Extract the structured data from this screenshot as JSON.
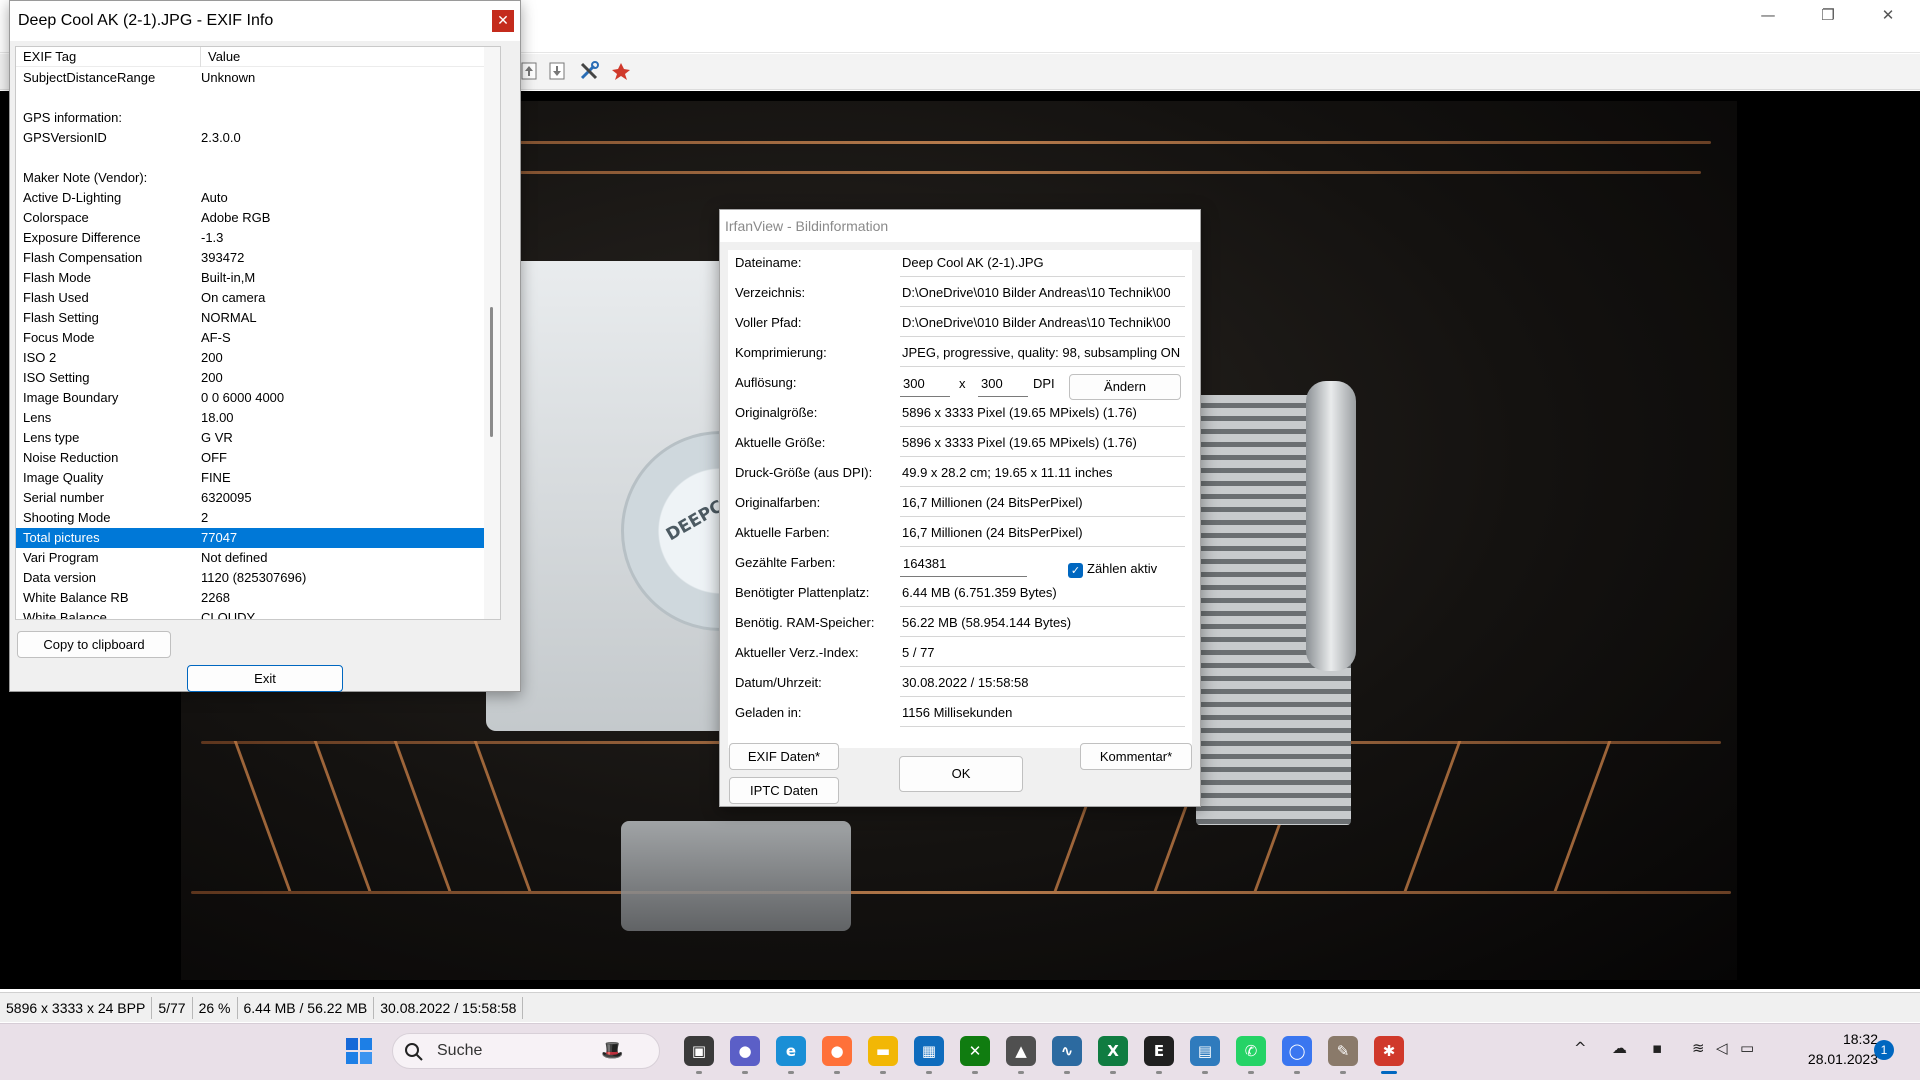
{
  "main_window": {
    "controls": {
      "minimize": "—",
      "maximize": "❐",
      "close": "✕"
    }
  },
  "toolbar_icons": [
    "move-up-icon",
    "move-down-icon",
    "tools-icon",
    "irfanview-icon"
  ],
  "photo": {
    "logo_text": "DEEPCOOL"
  },
  "statusbar": {
    "cells": [
      "5896 x 3333 x 24 BPP",
      "5/77",
      "26 %",
      "6.44 MB / 56.22 MB",
      "30.08.2022 / 15:58:58"
    ]
  },
  "exif_dialog": {
    "title": "Deep Cool AK (2-1).JPG - EXIF Info",
    "close": "✕",
    "columns": {
      "tag": "EXIF Tag",
      "value": "Value"
    },
    "rows": [
      {
        "tag": "SubjectDistanceRange",
        "value": "Unknown"
      },
      {
        "tag": "",
        "value": ""
      },
      {
        "tag": "GPS information:",
        "value": ""
      },
      {
        "tag": "GPSVersionID",
        "value": "2.3.0.0"
      },
      {
        "tag": "",
        "value": ""
      },
      {
        "tag": "Maker Note (Vendor):",
        "value": ""
      },
      {
        "tag": "Active D-Lighting",
        "value": "Auto"
      },
      {
        "tag": "Colorspace",
        "value": "Adobe RGB"
      },
      {
        "tag": "Exposure Difference",
        "value": "-1.3"
      },
      {
        "tag": "Flash Compensation",
        "value": "393472"
      },
      {
        "tag": "Flash Mode",
        "value": "Built-in,M"
      },
      {
        "tag": "Flash Used",
        "value": "On camera"
      },
      {
        "tag": "Flash Setting",
        "value": "NORMAL"
      },
      {
        "tag": "Focus Mode",
        "value": "AF-S"
      },
      {
        "tag": "ISO 2",
        "value": "200"
      },
      {
        "tag": "ISO Setting",
        "value": "200"
      },
      {
        "tag": "Image Boundary",
        "value": "0 0 6000 4000"
      },
      {
        "tag": "Lens",
        "value": "18.00"
      },
      {
        "tag": "Lens type",
        "value": "G VR"
      },
      {
        "tag": "Noise Reduction",
        "value": "OFF"
      },
      {
        "tag": "Image Quality",
        "value": "FINE"
      },
      {
        "tag": "Serial number",
        "value": "6320095"
      },
      {
        "tag": "Shooting Mode",
        "value": "2"
      },
      {
        "tag": "Total pictures",
        "value": "77047",
        "selected": true
      },
      {
        "tag": "Vari Program",
        "value": "Not defined"
      },
      {
        "tag": "Data version",
        "value": "1120 (825307696)"
      },
      {
        "tag": "White Balance RB",
        "value": "2268"
      },
      {
        "tag": "White Balance",
        "value": "CLOUDY"
      }
    ],
    "copy_button": "Copy to clipboard",
    "exit_button": "Exit"
  },
  "info_dialog": {
    "title": "IrfanView - Bildinformation",
    "rows": [
      {
        "label": "Dateiname:",
        "value": "Deep Cool AK (2-1).JPG"
      },
      {
        "label": "Verzeichnis:",
        "value": "D:\\OneDrive\\010 Bilder Andreas\\10 Technik\\00"
      },
      {
        "label": "Voller Pfad:",
        "value": "D:\\OneDrive\\010 Bilder Andreas\\10 Technik\\00"
      },
      {
        "label": "Komprimierung:",
        "value": "JPEG, progressive, quality: 98, subsampling ON"
      },
      {
        "label": "Auflösung:",
        "value": ""
      },
      {
        "label": "Originalgröße:",
        "value": "5896 x 3333  Pixel (19.65 MPixels) (1.76)"
      },
      {
        "label": "Aktuelle Größe:",
        "value": "5896 x 3333  Pixel (19.65 MPixels) (1.76)"
      },
      {
        "label": "Druck-Größe (aus DPI):",
        "value": "49.9 x 28.2 cm; 19.65 x 11.11 inches"
      },
      {
        "label": "Originalfarben:",
        "value": "16,7 Millionen   (24 BitsPerPixel)"
      },
      {
        "label": "Aktuelle Farben:",
        "value": "16,7 Millionen   (24 BitsPerPixel)"
      },
      {
        "label": "Gezählte Farben:",
        "value": ""
      },
      {
        "label": "Benötigter Plattenplatz:",
        "value": "6.44 MB (6.751.359 Bytes)"
      },
      {
        "label": "Benötig. RAM-Speicher:",
        "value": "56.22  MB (58.954.144 Bytes)"
      },
      {
        "label": "Aktueller Verz.-Index:",
        "value": "5  /  77"
      },
      {
        "label": "Datum/Uhrzeit:",
        "value": "30.08.2022 / 15:58:58"
      },
      {
        "label": "Geladen in:",
        "value": "1156 Millisekunden"
      }
    ],
    "resolution": {
      "x": "300",
      "separator": "x",
      "y": "300",
      "unit": "DPI",
      "change_button": "Ändern"
    },
    "counted_colors": {
      "value": "164381",
      "checkbox_label": "Zählen aktiv",
      "checked": true
    },
    "buttons": {
      "exif": "EXIF Daten*",
      "iptc": "IPTC Daten",
      "ok": "OK",
      "comment": "Kommentar*"
    }
  },
  "taskbar": {
    "search_placeholder": "Suche",
    "apps": [
      {
        "name": "task-view-icon",
        "color": "#3a3a3a",
        "glyph": "▣"
      },
      {
        "name": "teams-chat-icon",
        "color": "#5b5fc7",
        "glyph": "●"
      },
      {
        "name": "edge-icon",
        "color": "#1a8fd6",
        "glyph": "e"
      },
      {
        "name": "firefox-icon",
        "color": "#ff7139",
        "glyph": "●"
      },
      {
        "name": "file-explorer-icon",
        "color": "#f2b705",
        "glyph": "▬"
      },
      {
        "name": "store-icon",
        "color": "#0f6cbd",
        "glyph": "▦"
      },
      {
        "name": "xbox-icon",
        "color": "#107c10",
        "glyph": "✕"
      },
      {
        "name": "app-icon",
        "color": "#505050",
        "glyph": "▲"
      },
      {
        "name": "monitor-icon",
        "color": "#2c6aa0",
        "glyph": "∿"
      },
      {
        "name": "excel-icon",
        "color": "#107c41",
        "glyph": "X"
      },
      {
        "name": "epic-games-icon",
        "color": "#202020",
        "glyph": "E"
      },
      {
        "name": "control-panel-icon",
        "color": "#2f7bbd",
        "glyph": "▤"
      },
      {
        "name": "whatsapp-icon",
        "color": "#25d366",
        "glyph": "✆"
      },
      {
        "name": "signal-icon",
        "color": "#3a76f0",
        "glyph": "◯"
      },
      {
        "name": "gimp-icon",
        "color": "#8a7a6a",
        "glyph": "✎"
      },
      {
        "name": "irfanview-taskbar-icon",
        "color": "#d0392b",
        "glyph": "✱"
      }
    ],
    "tray": {
      "chevron": "^",
      "time": "18:32",
      "date": "28.01.2023",
      "notifications": "1"
    }
  }
}
